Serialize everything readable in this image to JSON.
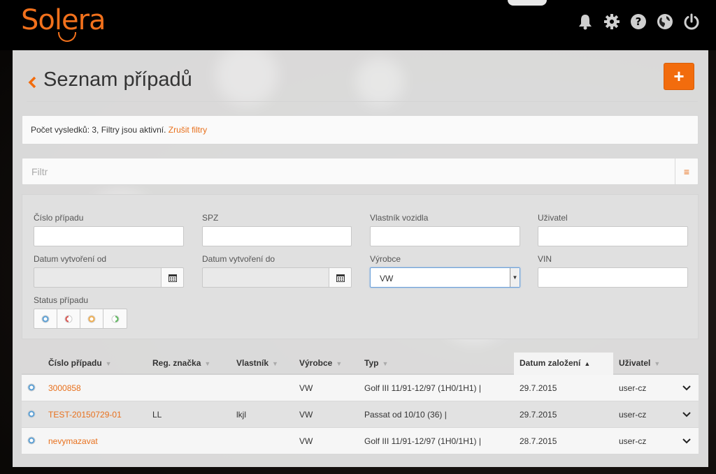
{
  "app": {
    "logo_text": "Solera",
    "brand_color": "#f26c0d"
  },
  "topbar": {
    "icons": [
      "bell-icon",
      "gear-icon",
      "help-icon",
      "globe-icon",
      "power-icon"
    ]
  },
  "page": {
    "title": "Seznam případů",
    "add_label": "+"
  },
  "info": {
    "text": "Počet vysledků: 3, Filtry jsou aktivní.",
    "link": "Zrušit filtry"
  },
  "filter": {
    "placeholder": "Filtr",
    "menu_icon": "≡"
  },
  "form": {
    "case_number_label": "Číslo případu",
    "plate_label": "SPZ",
    "owner_label": "Vlastník vozidla",
    "user_label": "Uživatel",
    "created_from_label": "Datum vytvoření od",
    "created_to_label": "Datum vytvoření do",
    "manufacturer_label": "Výrobce",
    "manufacturer_value": "VW",
    "vin_label": "VIN",
    "status_label": "Status případu"
  },
  "table": {
    "columns": [
      "Číslo případu",
      "Reg. značka",
      "Vlastník",
      "Výrobce",
      "Typ",
      "Datum založení",
      "Uživatel"
    ],
    "sort_column": "Datum založení",
    "rows": [
      {
        "case": "3000858",
        "plate": "",
        "owner": "",
        "make": "VW",
        "type": "Golf III 11/91-12/97 (1H0/1H1) |",
        "date": "29.7.2015",
        "user": "user-cz"
      },
      {
        "case": "TEST-20150729-01",
        "plate": "LL",
        "owner": "lkjl",
        "make": "VW",
        "type": "Passat od 10/10 (36) |",
        "date": "29.7.2015",
        "user": "user-cz"
      },
      {
        "case": "nevymazavat",
        "plate": "",
        "owner": "",
        "make": "VW",
        "type": "Golf III 11/91-12/97 (1H0/1H1) |",
        "date": "28.7.2015",
        "user": "user-cz"
      }
    ]
  }
}
